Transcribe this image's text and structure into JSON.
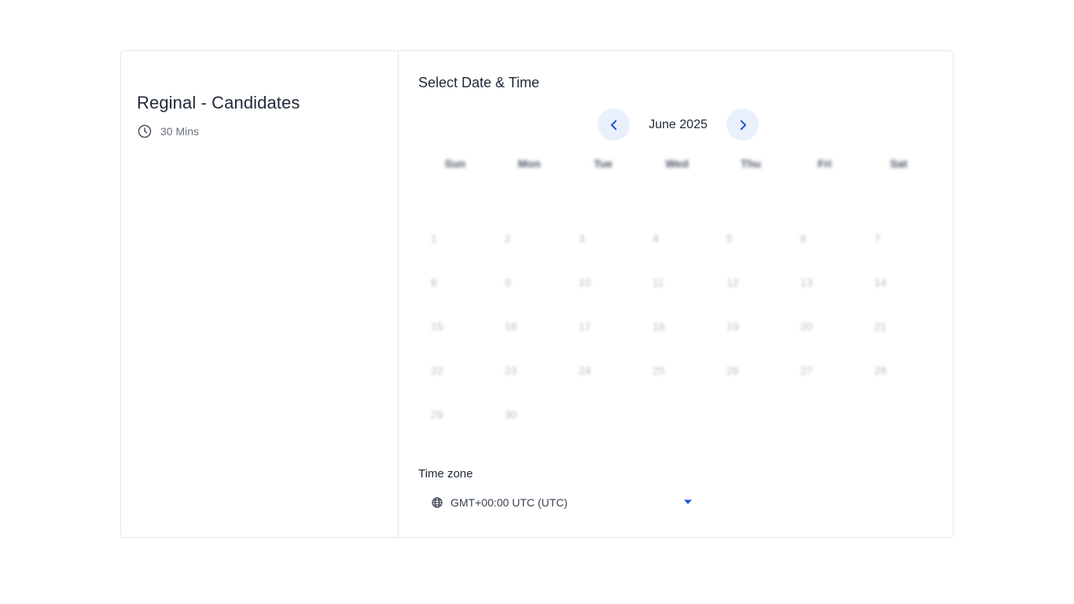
{
  "event": {
    "title": "Reginal - Candidates",
    "duration": "30 Mins"
  },
  "calendar": {
    "heading": "Select Date & Time",
    "month_label": "June 2025",
    "weekdays": [
      "Sun",
      "Mon",
      "Tue",
      "Wed",
      "Thu",
      "Fri",
      "Sat"
    ],
    "days": [
      "1",
      "2",
      "3",
      "4",
      "5",
      "6",
      "7",
      "8",
      "9",
      "10",
      "11",
      "12",
      "13",
      "14",
      "15",
      "16",
      "17",
      "18",
      "19",
      "20",
      "21",
      "22",
      "23",
      "24",
      "25",
      "26",
      "27",
      "28",
      "29",
      "30"
    ]
  },
  "timezone": {
    "label": "Time zone",
    "value": "GMT+00:00 UTC (UTC)"
  },
  "colors": {
    "accent": "#1a56db",
    "nav_bg": "#eaf0fb",
    "border": "#e5e7eb"
  }
}
